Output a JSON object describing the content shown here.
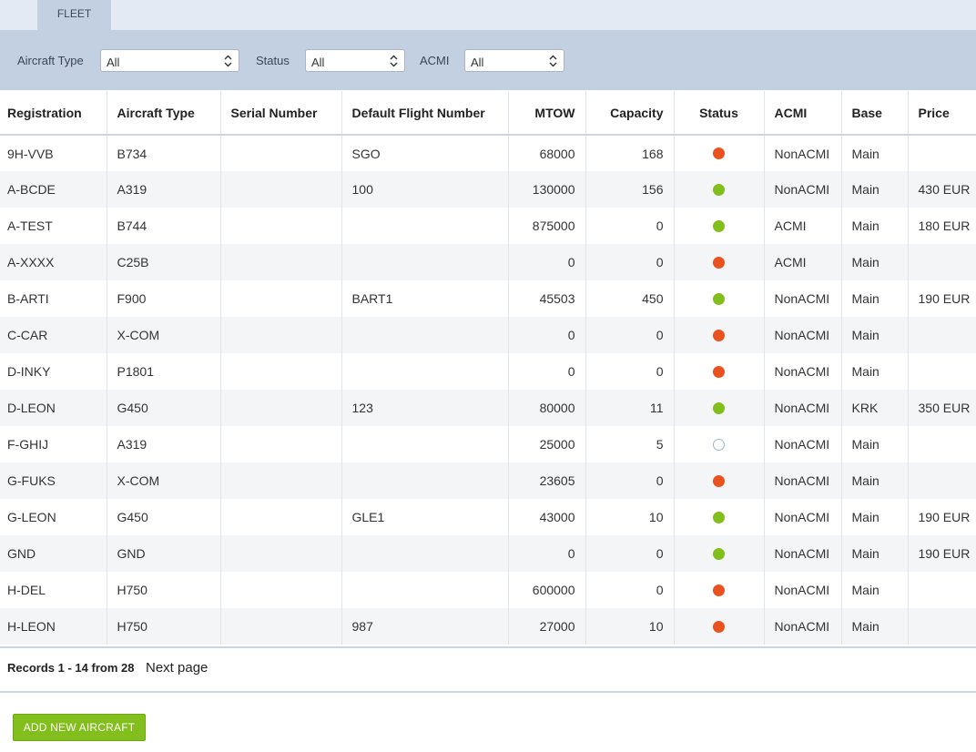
{
  "tabs": {
    "fleet": "FLEET"
  },
  "filters": {
    "aircraft_type": {
      "label": "Aircraft Type",
      "value": "All"
    },
    "status": {
      "label": "Status",
      "value": "All"
    },
    "acmi": {
      "label": "ACMI",
      "value": "All"
    }
  },
  "table": {
    "headers": [
      "Registration",
      "Aircraft Type",
      "Serial Number",
      "Default Flight Number",
      "MTOW",
      "Capacity",
      "Status",
      "ACMI",
      "Base",
      "Price"
    ],
    "rows": [
      {
        "registration": "9H-VVB",
        "type": "B734",
        "serial": "",
        "flight": "SGO",
        "mtow": "68000",
        "capacity": "168",
        "status": "red",
        "acmi": "NonACMI",
        "base": "Main",
        "price": ""
      },
      {
        "registration": "A-BCDE",
        "type": "A319",
        "serial": "",
        "flight": "100",
        "mtow": "130000",
        "capacity": "156",
        "status": "green",
        "acmi": "NonACMI",
        "base": "Main",
        "price": "430 EUR"
      },
      {
        "registration": "A-TEST",
        "type": "B744",
        "serial": "",
        "flight": "",
        "mtow": "875000",
        "capacity": "0",
        "status": "green",
        "acmi": "ACMI",
        "base": "Main",
        "price": "180 EUR"
      },
      {
        "registration": "A-XXXX",
        "type": "C25B",
        "serial": "",
        "flight": "",
        "mtow": "0",
        "capacity": "0",
        "status": "red",
        "acmi": "ACMI",
        "base": "Main",
        "price": ""
      },
      {
        "registration": "B-ARTI",
        "type": "F900",
        "serial": "",
        "flight": "BART1",
        "mtow": "45503",
        "capacity": "450",
        "status": "green",
        "acmi": "NonACMI",
        "base": "Main",
        "price": "190 EUR"
      },
      {
        "registration": "C-CAR",
        "type": "X-COM",
        "serial": "",
        "flight": "",
        "mtow": "0",
        "capacity": "0",
        "status": "red",
        "acmi": "NonACMI",
        "base": "Main",
        "price": ""
      },
      {
        "registration": "D-INKY",
        "type": "P1801",
        "serial": "",
        "flight": "",
        "mtow": "0",
        "capacity": "0",
        "status": "red",
        "acmi": "NonACMI",
        "base": "Main",
        "price": ""
      },
      {
        "registration": "D-LEON",
        "type": "G450",
        "serial": "",
        "flight": "123",
        "mtow": "80000",
        "capacity": "11",
        "status": "green",
        "acmi": "NonACMI",
        "base": "KRK",
        "price": "350 EUR"
      },
      {
        "registration": "F-GHIJ",
        "type": "A319",
        "serial": "",
        "flight": "",
        "mtow": "25000",
        "capacity": "5",
        "status": "empty",
        "acmi": "NonACMI",
        "base": "Main",
        "price": ""
      },
      {
        "registration": "G-FUKS",
        "type": "X-COM",
        "serial": "",
        "flight": "",
        "mtow": "23605",
        "capacity": "0",
        "status": "red",
        "acmi": "NonACMI",
        "base": "Main",
        "price": ""
      },
      {
        "registration": "G-LEON",
        "type": "G450",
        "serial": "",
        "flight": "GLE1",
        "mtow": "43000",
        "capacity": "10",
        "status": "green",
        "acmi": "NonACMI",
        "base": "Main",
        "price": "190 EUR"
      },
      {
        "registration": "GND",
        "type": "GND",
        "serial": "",
        "flight": "",
        "mtow": "0",
        "capacity": "0",
        "status": "green",
        "acmi": "NonACMI",
        "base": "Main",
        "price": "190 EUR"
      },
      {
        "registration": "H-DEL",
        "type": "H750",
        "serial": "",
        "flight": "",
        "mtow": "600000",
        "capacity": "0",
        "status": "red",
        "acmi": "NonACMI",
        "base": "Main",
        "price": ""
      },
      {
        "registration": "H-LEON",
        "type": "H750",
        "serial": "",
        "flight": "987",
        "mtow": "27000",
        "capacity": "10",
        "status": "red",
        "acmi": "NonACMI",
        "base": "Main",
        "price": ""
      }
    ]
  },
  "pagination": {
    "records": "Records 1 - 14 from 28",
    "next": "Next page"
  },
  "add_button": "ADD NEW AIRCRAFT",
  "colors": {
    "status_red": "#e9511f",
    "status_green": "#82bf1c",
    "accent": "#82bf1c",
    "filter_bg": "#c3d0e1"
  }
}
